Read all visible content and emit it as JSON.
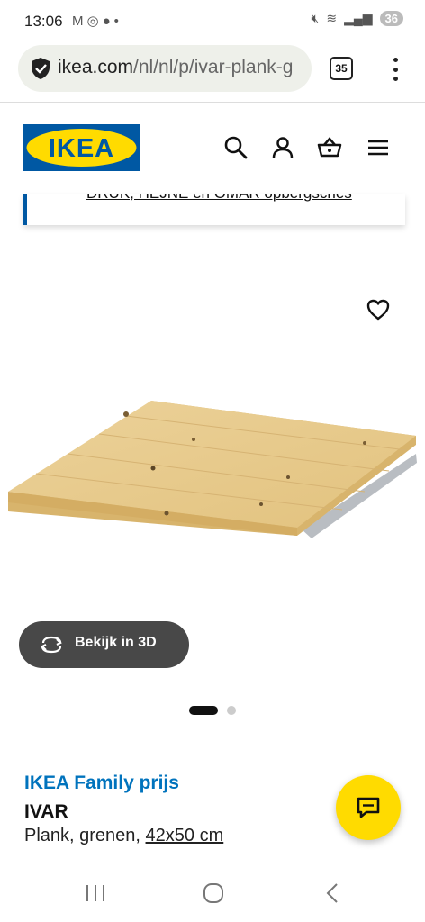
{
  "status": {
    "time": "13:06",
    "battery": "36"
  },
  "browser": {
    "url_host": "ikea.com",
    "url_path": "/nl/nl/p/ivar-plank-g",
    "tab_count": "35"
  },
  "header": {
    "logo": "IKEA"
  },
  "banner": {
    "link_text": "DRUK, HEJNE en OMAR opbergsches"
  },
  "product": {
    "view_3d_label": "Bekijk in 3D",
    "family_price_label": "IKEA Family prijs",
    "name": "IVAR",
    "description": "Plank, grenen, ",
    "size": "42x50 cm",
    "image_count": 2,
    "active_image": 1
  },
  "colors": {
    "ikea_blue": "#0058a3",
    "ikea_yellow": "#ffdb00",
    "family_blue": "#0073bd"
  }
}
